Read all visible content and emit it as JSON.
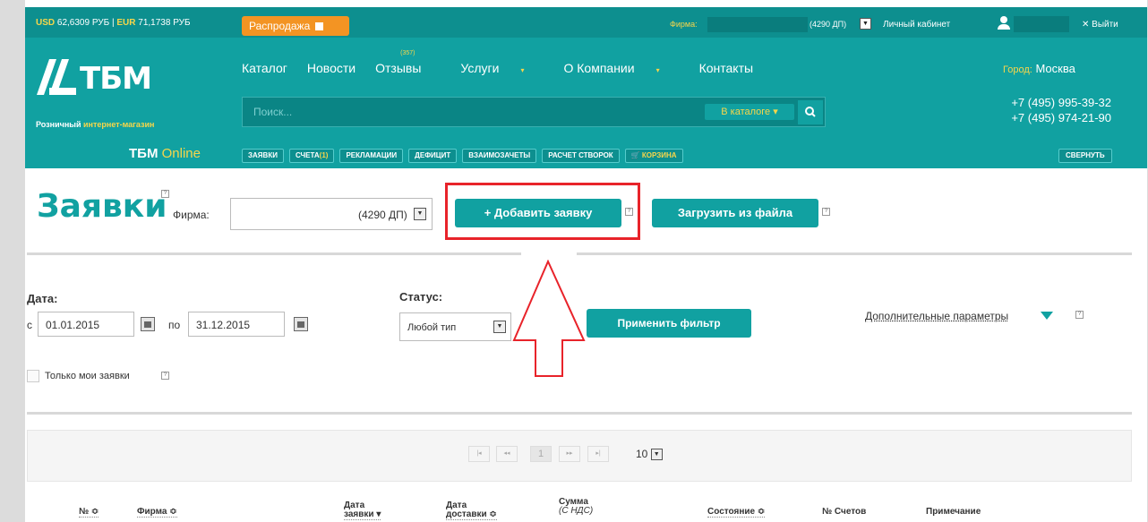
{
  "topbar": {
    "usd_label": "USD",
    "usd_value": "62,6309 РУБ",
    "separator": "|",
    "eur_label": "EUR",
    "eur_value": "71,1738 РУБ",
    "sale": "Распродажа",
    "firm_label": "Фирма:",
    "firm_dp": "(4290 ДП)",
    "cabinet": "Личный кабинет",
    "logout": "✕ Выйти"
  },
  "logo": {
    "text": "ТБМ",
    "tagline_a": "Розничный",
    "tagline_b": "интернет-магазин"
  },
  "nav": {
    "items": [
      "Каталог",
      "Новости",
      "Отзывы",
      "Услуги",
      "О Компании",
      "Контакты"
    ],
    "reviews_count": "(357)",
    "dropdown_arrow": "▾"
  },
  "city": {
    "label": "Город:",
    "value": "Москва"
  },
  "phones": [
    "+7 (495) 995-39-32",
    "+7 (495) 974-21-90"
  ],
  "search": {
    "placeholder": "Поиск...",
    "scope": "В каталоге ▾"
  },
  "online": {
    "a": "ТБМ",
    "b": "Online"
  },
  "tabs": [
    "ЗАЯВКИ",
    "СЧЕТА",
    "РЕКЛАМАЦИИ",
    "ДЕФИЦИТ",
    "ВЗАИМОЗАЧЕТЫ",
    "РАСЧЕТ СТВОРОК",
    "КОРЗИНА"
  ],
  "tab_count": "(1)",
  "collapse": "СВЕРНУТЬ",
  "page": {
    "title": "Заявки",
    "firm_label": "Фирма:",
    "firm_dp": "(4290 ДП)",
    "add_button": "+ Добавить заявку",
    "upload_button": "Загрузить из файла",
    "help_glyph": "?"
  },
  "filter": {
    "date_label": "Дата:",
    "from_label": "с",
    "from_value": "01.01.2015",
    "to_label": "по",
    "to_value": "31.12.2015",
    "status_label": "Статус:",
    "status_value": "Любой тип",
    "apply_button": "Применить фильтр",
    "extra_params": "Дополнительные параметры",
    "only_mine": "Только мои заявки"
  },
  "pager": {
    "first": "|◂",
    "prev": "◂◂",
    "current": "1",
    "next": "▸▸",
    "last": "▸|",
    "per_page": "10"
  },
  "table": {
    "headers": {
      "num": "№ ≎",
      "firm": "Фирма ≎",
      "order_date_a": "Дата",
      "order_date_b": "заявки ▾",
      "delivery_date_a": "Дата",
      "delivery_date_b": "доставки ≎",
      "sum_a": "Сумма",
      "sum_b": "(С НДС)",
      "state": "Состояние ≎",
      "invoices": "№ Счетов",
      "note": "Примечание"
    }
  },
  "colors": {
    "brand": "#11a1a1",
    "accent": "#f7d64a",
    "highlight": "#e8232a",
    "sale": "#f39423"
  }
}
